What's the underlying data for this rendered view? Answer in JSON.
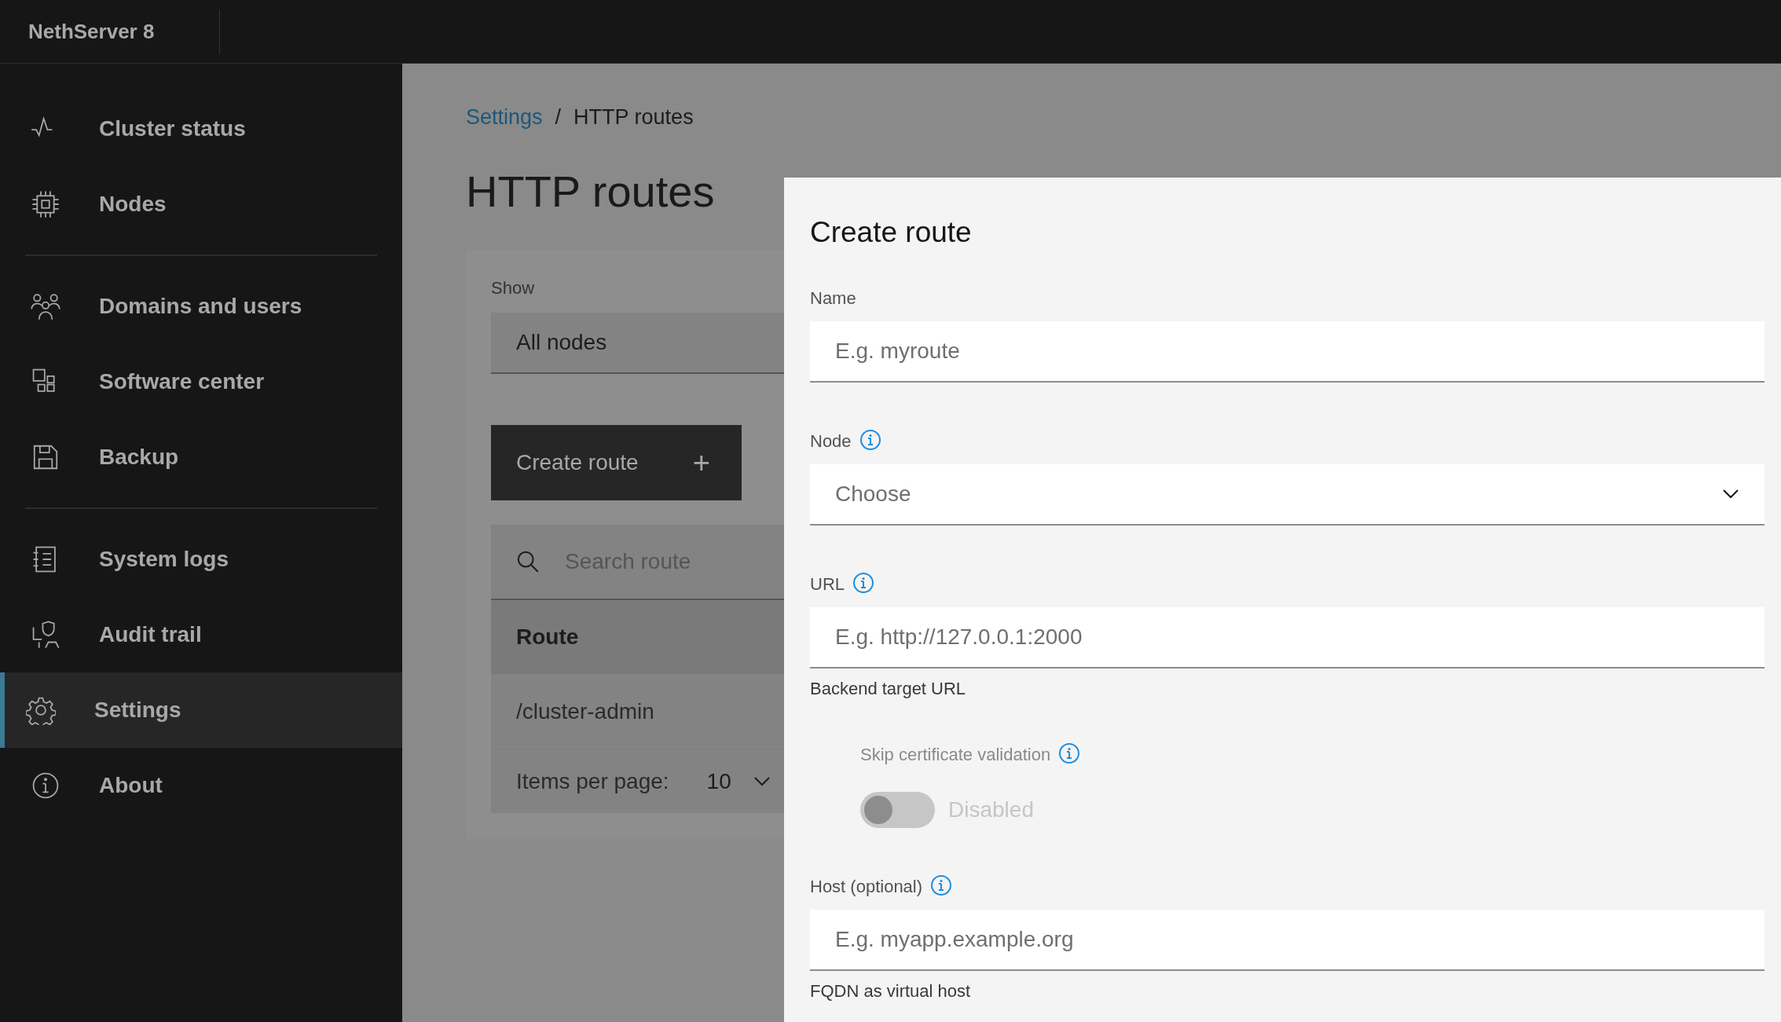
{
  "header": {
    "title": "NethServer 8"
  },
  "sidebar": {
    "groups": [
      [
        {
          "label": "Cluster status",
          "selected": false
        },
        {
          "label": "Nodes",
          "selected": false
        }
      ],
      [
        {
          "label": "Domains and users",
          "selected": false
        },
        {
          "label": "Software center",
          "selected": false
        },
        {
          "label": "Backup",
          "selected": false
        }
      ],
      [
        {
          "label": "System logs",
          "selected": false
        },
        {
          "label": "Audit trail",
          "selected": false
        },
        {
          "label": "Settings",
          "selected": true
        },
        {
          "label": "About",
          "selected": false
        }
      ]
    ]
  },
  "main": {
    "breadcrumb": {
      "link": "Settings",
      "separator": "/",
      "current": "HTTP routes"
    },
    "title": "HTTP routes",
    "filter": {
      "label": "Show",
      "value": "All nodes"
    },
    "create_button": {
      "label": "Create route",
      "icon": "+"
    },
    "search": {
      "placeholder": "Search route"
    },
    "table": {
      "columns": [
        "Route"
      ],
      "rows": [
        [
          "/cluster-admin"
        ]
      ]
    },
    "pagination": {
      "label": "Items per page:",
      "value": "10"
    }
  },
  "panel": {
    "title": "Create route",
    "fields": [
      {
        "kind": "input",
        "label": "Name",
        "info": false,
        "placeholder": "E.g. myroute"
      },
      {
        "kind": "select",
        "label": "Node",
        "info": true,
        "value": "Choose"
      },
      {
        "kind": "input",
        "label": "URL",
        "info": true,
        "placeholder": "E.g. http://127.0.0.1:2000",
        "helper": "Backend target URL"
      },
      {
        "kind": "toggle",
        "label": "Skip certificate validation",
        "info": true,
        "on": false,
        "disabled": true,
        "state_label": "Disabled"
      },
      {
        "kind": "input",
        "label": "Host (optional)",
        "info": true,
        "placeholder": "E.g. myapp.example.org",
        "helper": "FQDN as virtual host"
      }
    ]
  }
}
